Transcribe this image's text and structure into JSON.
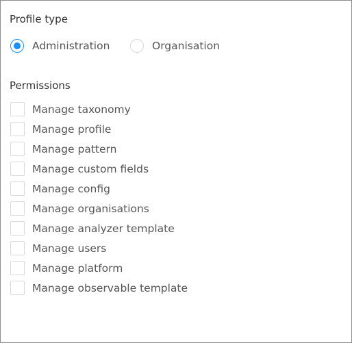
{
  "profile_type": {
    "title": "Profile type",
    "options": [
      {
        "label": "Administration",
        "selected": true
      },
      {
        "label": "Organisation",
        "selected": false
      }
    ]
  },
  "permissions": {
    "title": "Permissions",
    "items": [
      {
        "label": "Manage taxonomy",
        "checked": false
      },
      {
        "label": "Manage profile",
        "checked": false
      },
      {
        "label": "Manage pattern",
        "checked": false
      },
      {
        "label": "Manage custom fields",
        "checked": false
      },
      {
        "label": "Manage config",
        "checked": false
      },
      {
        "label": "Manage organisations",
        "checked": false
      },
      {
        "label": "Manage analyzer template",
        "checked": false
      },
      {
        "label": "Manage users",
        "checked": false
      },
      {
        "label": "Manage platform",
        "checked": false
      },
      {
        "label": "Manage observable template",
        "checked": false
      }
    ]
  },
  "colors": {
    "accent": "#1890ff",
    "border": "#d9d9d9",
    "panel_border": "#8c8c8c",
    "text": "#555555"
  }
}
